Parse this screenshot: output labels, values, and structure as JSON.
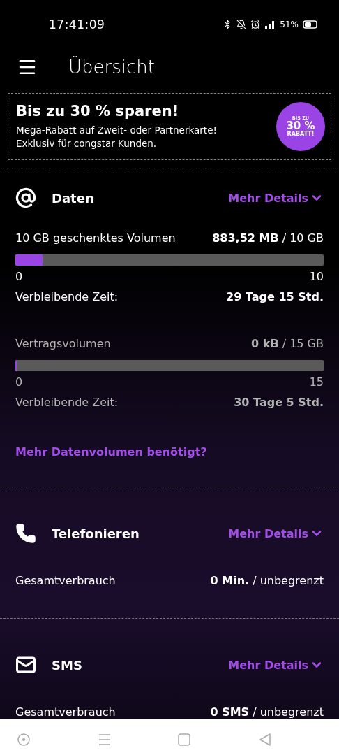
{
  "status_bar": {
    "time": "17:41:09",
    "battery": "51%"
  },
  "header": {
    "title": "Übersicht"
  },
  "promo": {
    "title": "Bis zu 30 % sparen!",
    "lines": [
      "Mega-Rabatt auf Zweit- oder Partnerkarte!",
      "Exklusiv für congstar Kunden."
    ],
    "badge": [
      "BIS ZU",
      "30 %",
      "RABATT!"
    ]
  },
  "sections": [
    {
      "kind": "data",
      "title": "Daten",
      "details": "Mehr Details",
      "meters": [
        {
          "label": "10 GB geschenktes Volumen",
          "value": "**883,52 MB** / 10 GB",
          "level": 0.088,
          "min": "0",
          "max": "10",
          "time_label": "Verbleibende Zeit:",
          "time": "29 Tage 15 Std.",
          "disabled": false
        },
        {
          "label": "Vertragsvolumen",
          "value": "**0 kB** / 15 GB",
          "level": 0,
          "min": "0",
          "max": "15",
          "time_label": "Verbleibende Zeit:",
          "time": "30 Tage 5 Std.",
          "disabled": true
        }
      ],
      "link": "Mehr Datenvolumen benötigt?"
    },
    {
      "kind": "phone",
      "title": "Telefonieren",
      "details": "Mehr Details",
      "usage_label": "Gesamtverbrauch",
      "usage": "**0 Min.** / unbegrenzt"
    },
    {
      "kind": "sms",
      "title": "SMS",
      "details": "Mehr Details",
      "usage_label": "Gesamtverbrauch",
      "usage": "**0 SMS** / unbegrenzt"
    }
  ]
}
